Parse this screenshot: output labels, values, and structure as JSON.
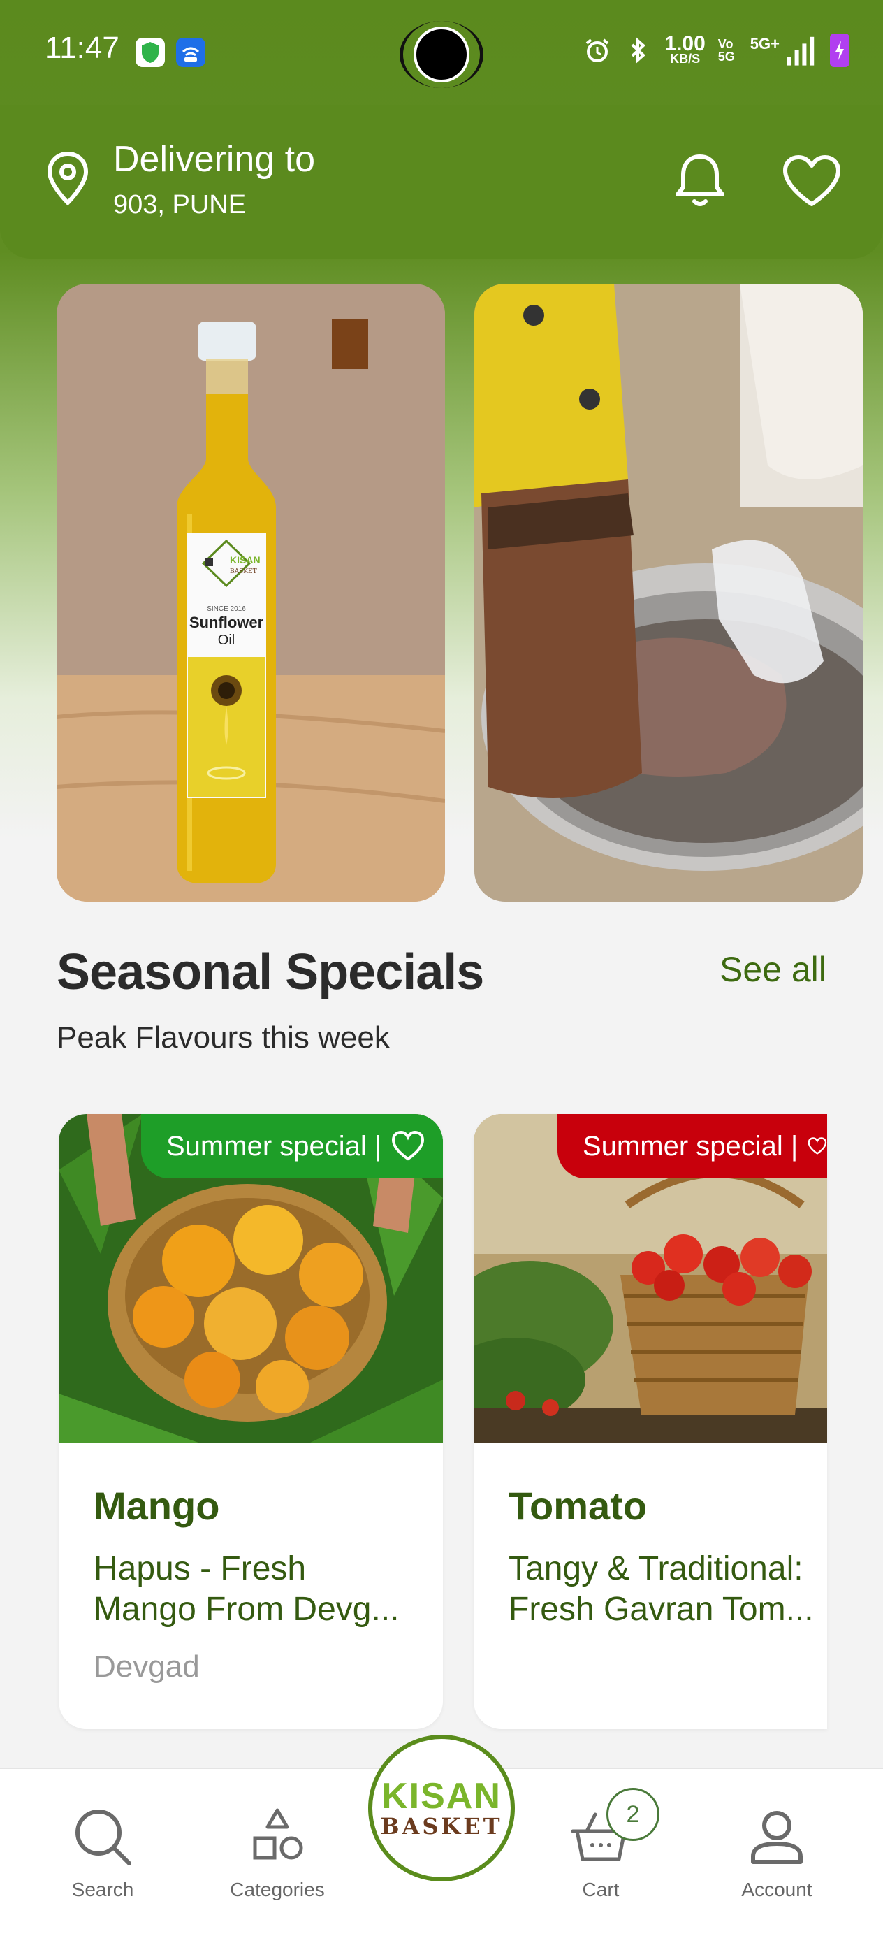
{
  "status_bar": {
    "time": "11:47",
    "net_speed_value": "1.00",
    "net_speed_unit": "KB/S",
    "volte": "Vo 5G",
    "network": "5G+"
  },
  "header": {
    "delivering_label": "Delivering to",
    "address": "903, PUNE"
  },
  "banners": [
    {
      "label_brand": "KISAN BASKET",
      "label_since": "SINCE 2016",
      "label_product": "Sunflower",
      "label_product_2": "Oil"
    }
  ],
  "section": {
    "title": "Seasonal Specials",
    "subtitle": "Peak Flavours this week",
    "see_all": "See all"
  },
  "products": [
    {
      "badge": "Summer special |",
      "badge_color": "#1e9e28",
      "name": "Mango",
      "description": "Hapus - Fresh Mango From Devg...",
      "origin": "Devgad"
    },
    {
      "badge": "Summer special |",
      "badge_color": "#c8000c",
      "name": "Tomato",
      "description": "Tangy & Traditional: Fresh Gavran Tom...",
      "origin": ""
    }
  ],
  "bottom_nav": {
    "search": "Search",
    "categories": "Categories",
    "logo_top": "KISAN",
    "logo_bottom": "BASKET",
    "cart": "Cart",
    "cart_count": "2",
    "account": "Account"
  },
  "colors": {
    "brand_green": "#5b8a1e",
    "title_green": "#345a10",
    "see_all_green": "#3d6a10"
  }
}
